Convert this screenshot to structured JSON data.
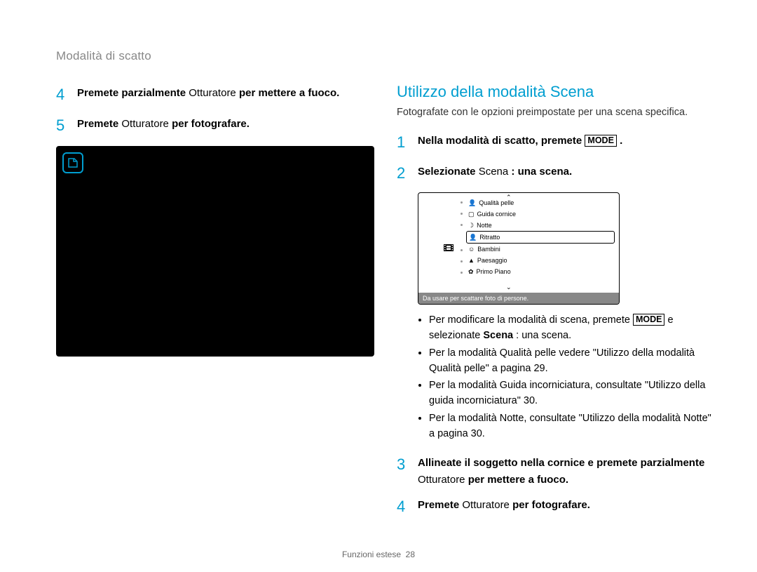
{
  "breadcrumb": "Modalità di scatto",
  "left": {
    "step4_num": "4",
    "step4_body_a": "Premete parzialmente ",
    "step4_body_b": "Otturatore",
    "step4_body_c": " per mettere a fuoco.",
    "step5_num": "5",
    "step5_body_a": "Premete ",
    "step5_body_b": "Otturatore",
    "step5_body_c": " per fotografare."
  },
  "right": {
    "heading": "Utilizzo della modalità Scena",
    "subtext": "Fotografate con le opzioni preimpostate per una scena specifica.",
    "step1_num": "1",
    "step1_a": "Nella modalità di scatto, premete ",
    "step1_mode": "MODE",
    "step1_b": " .",
    "step2_num": "2",
    "step2_a": "Selezionate ",
    "step2_b": "Scena",
    "step2_c": "  : una scena.",
    "scene_items": {
      "i0": "Qualità pelle",
      "i1": "Guida cornice",
      "i2": "Notte",
      "i3": "Ritratto",
      "i4": "Bambini",
      "i5": "Paesaggio",
      "i6": "Primo Piano"
    },
    "scene_tip": "Da usare per scattare foto di persone.",
    "bullets": {
      "b0a": "Per modificare la modalità di scena, premete ",
      "b0mode": "MODE",
      "b0b": " e selezionate ",
      "b0c": "Scena",
      "b0d": "  : una scena.",
      "b1": "Per la modalità Qualità pelle vedere \"Utilizzo della modalità Qualità pelle\" a pagina 29.",
      "b2": "Per la modalità Guida incorniciatura, consultate \"Utilizzo della guida incorniciatura\" 30.",
      "b3": "Per la modalità Notte, consultate \"Utilizzo della modalità Notte\" a pagina 30."
    },
    "step3_num": "3",
    "step3_a": "Allineate il soggetto nella cornice e premete parzialmente ",
    "step3_b": "Otturatore",
    "step3_c": " per mettere a fuoco.",
    "step4_num": "4",
    "step4_a": "Premete ",
    "step4_b": "Otturatore",
    "step4_c": " per fotografare."
  },
  "footer": {
    "section": "Funzioni estese",
    "page": "28"
  }
}
